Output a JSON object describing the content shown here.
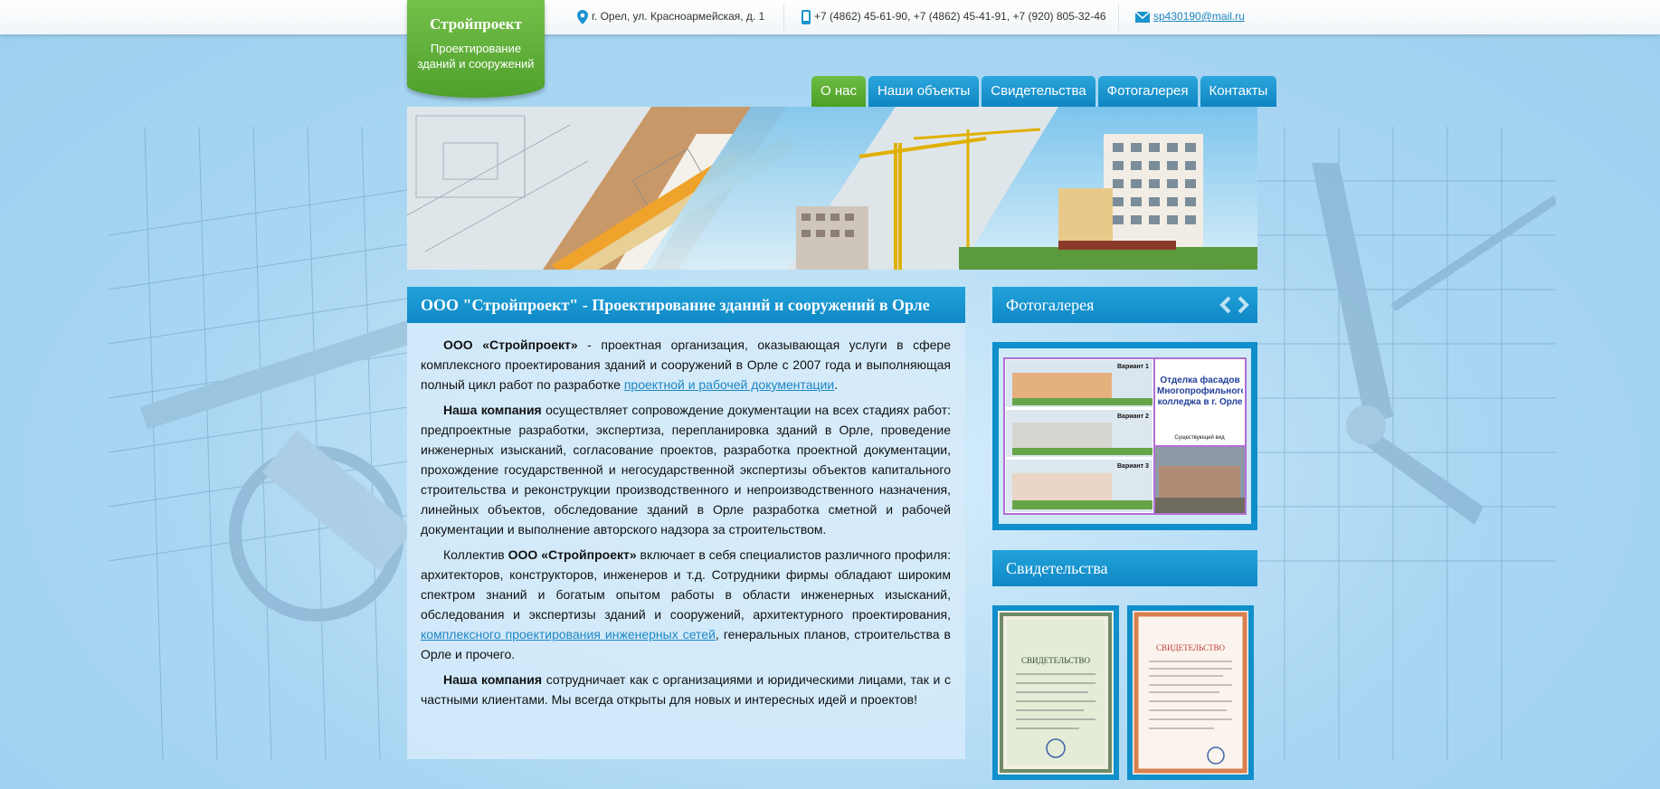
{
  "header": {
    "logo_title": "Стройпроект",
    "logo_subtitle": "Проектирование зданий и сооружений",
    "address": "г. Орел, ул. Красноармейская, д. 1",
    "phones": "+7 (4862) 45-61-90, +7 (4862) 45-41-91, +7 (920) 805-32-46",
    "email": "sp430190@mail.ru"
  },
  "nav": {
    "items": [
      {
        "label": "О нас",
        "active": true
      },
      {
        "label": "Наши объекты"
      },
      {
        "label": "Свидетельства"
      },
      {
        "label": "Фотогалерея"
      },
      {
        "label": "Контакты"
      }
    ]
  },
  "main": {
    "heading": "ООО \"Стройпроект\" - Проектирование зданий и сооружений в Орле",
    "p1_bold": "ООО «Стройпроект»",
    "p1_text": " - проектная организация, оказывающая услуги в сфере комплексного проектирования зданий и сооружений в Орле с 2007 года и выполняющая полный цикл работ по разработке ",
    "p1_link": "проектной и рабочей документации",
    "p1_end": ".",
    "p2_bold": "Наша компания",
    "p2_text": " осуществляет сопровождение документации на всех стадиях работ: предпроектные разработки, экспертиза, перепланировка зданий в Орле, проведение инженерных изысканий, согласование проектов, разработка проектной документации, прохождение государственной и негосударственной экспертизы объектов капитального строительства и реконструкции производственного и непроизводственного назначения, линейных объектов, обследование зданий в Орле разработка сметной и рабочей документации и выполнение авторского надзора за строительством.",
    "p3_start": "Коллектив ",
    "p3_bold": "ООО «Стройпроект»",
    "p3_text": " включает в себя специалистов различного профиля: архитекторов, конструкторов, инженеров и т.д. Сотрудники фирмы обладают широким спектром знаний и богатым опытом работы в области инженерных изысканий, обследования и экспертизы зданий и сооружений, архитектурного проектирования, ",
    "p3_link": "комплексного проектирования инженерных сетей",
    "p3_end": ", генеральных планов, строительства в Орле и прочего.",
    "p4_bold": "Наша компания",
    "p4_text": " сотрудничает как с организациями и юридическими лицами, так и с частными клиентами. Мы всегда открыты для новых и интересных идей и проектов!"
  },
  "sidebar": {
    "gallery_title": "Фотогалерея",
    "gallery_image": {
      "variant1": "Вариант 1",
      "variant2": "Вариант 2",
      "variant3": "Вариант 3",
      "caption": "Отделка фасадов Многопрофильного колледжа в г. Орле",
      "existing": "Существующий вид"
    },
    "certs_title": "Свидетельства",
    "cert1_title": "СВИДЕТЕЛЬСТВО",
    "cert2_title": "СВИДЕТЕЛЬСТВО"
  },
  "colors": {
    "accent_blue": "#1497d1",
    "accent_green": "#5cae35",
    "link": "#1d86c4"
  }
}
